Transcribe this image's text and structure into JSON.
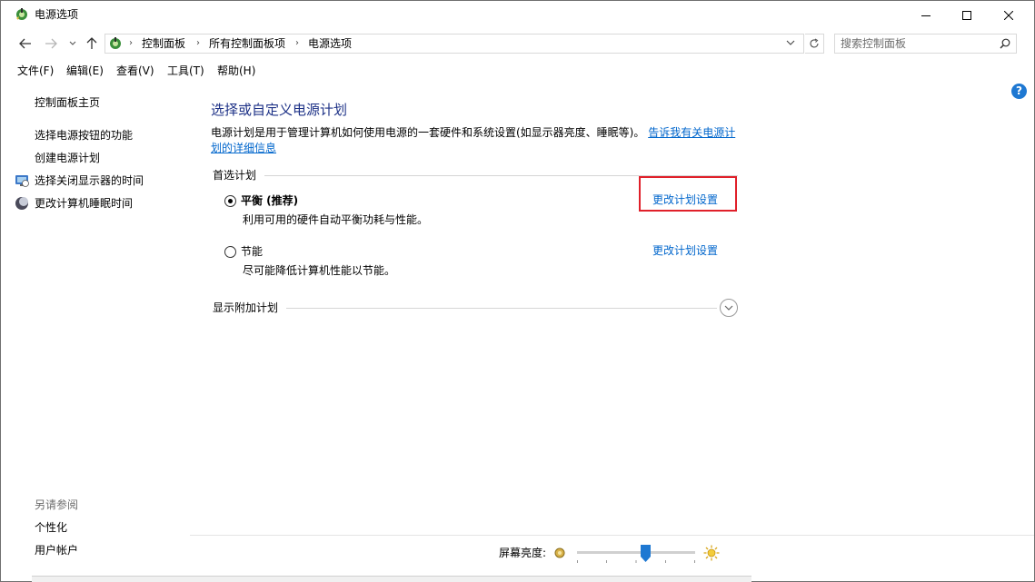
{
  "window": {
    "title": "电源选项"
  },
  "address": {
    "crumbs": [
      "控制面板",
      "所有控制面板项",
      "电源选项"
    ],
    "search_placeholder": "搜索控制面板"
  },
  "menu": {
    "items": [
      "文件(F)",
      "编辑(E)",
      "查看(V)",
      "工具(T)",
      "帮助(H)"
    ]
  },
  "sidebar": {
    "home": "控制面板主页",
    "links": [
      "选择电源按钮的功能",
      "创建电源计划",
      "选择关闭显示器的时间",
      "更改计算机睡眠时间"
    ],
    "see_also_title": "另请参阅",
    "see_also": [
      "个性化",
      "用户帐户"
    ]
  },
  "main": {
    "title": "选择或自定义电源计划",
    "description": "电源计划是用于管理计算机如何使用电源的一套硬件和系统设置(如显示器亮度、睡眠等)。",
    "description_link": "告诉我有关电源计划的详细信息",
    "preferred_label": "首选计划",
    "plans": [
      {
        "name": "平衡 (推荐)",
        "description": "利用可用的硬件自动平衡功耗与性能。",
        "link": "更改计划设置",
        "selected": true
      },
      {
        "name": "节能",
        "description": "尽可能降低计算机性能以节能。",
        "link": "更改计划设置",
        "selected": false
      }
    ],
    "additional_label": "显示附加计划",
    "help": "?"
  },
  "brightness": {
    "label": "屏幕亮度:",
    "level_percent": 58
  },
  "colors": {
    "accent_link": "#0066cc",
    "title_blue": "#1e3287",
    "highlight_red": "#e0202a",
    "slider_thumb": "#1e78d2"
  }
}
